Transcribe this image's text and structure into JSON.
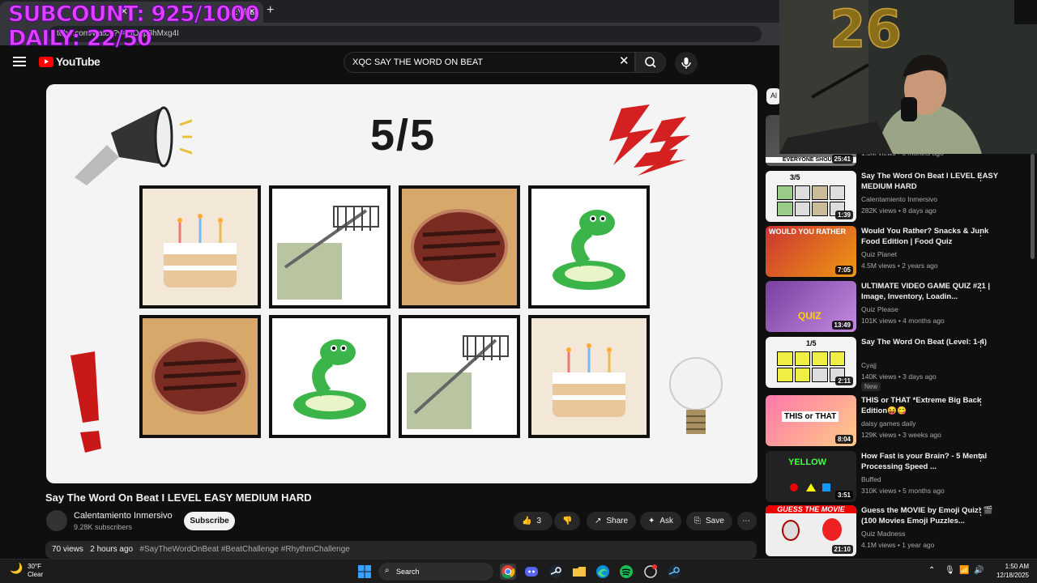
{
  "overlay": {
    "subcount": "SUBCOUNT: 925/1000",
    "daily": "DAILY: 22/50"
  },
  "browser": {
    "tab_title": "LEVEL",
    "url": "tube.com/watch?v=HOgp8hMxg4I"
  },
  "youtube": {
    "logo_text": "YouTube",
    "search_query": "XQC SAY THE WORD ON BEAT"
  },
  "video": {
    "score_text": "5/5",
    "grid_items": [
      "cake",
      "rake",
      "steak",
      "snake",
      "steak",
      "snake",
      "rake",
      "cake"
    ],
    "title": "Say The Word On Beat I LEVEL EASY MEDIUM HARD",
    "channel": "Calentamiento Inmersivo",
    "subscribers": "9.28K subscribers",
    "subscribe_label": "Subscribe",
    "like_count": "3",
    "share_label": "Share",
    "ask_label": "Ask",
    "save_label": "Save",
    "views": "70 views",
    "posted": "2 hours ago",
    "hashtags": "#SayTheWordOnBeat #BeatChallenge #RhythmChallenge"
  },
  "sidebar": {
    "chip_all": "Al",
    "first_meta": "1.3M views • 6 months ago",
    "first_thumb_caption": "EVERYONE SHOULD",
    "first_duration": "25:41",
    "items": [
      {
        "title": "Say The Word On Beat I LEVEL EASY MEDIUM HARD",
        "channel": "Calentamiento Inmersivo",
        "meta": "282K views • 8 days ago",
        "duration": "1:39",
        "thumb_text": "3/5"
      },
      {
        "title": "Would You Rather? Snacks & Junk Food Edition | Food Quiz",
        "channel": "Quiz Planet",
        "meta": "4.5M views • 2 years ago",
        "duration": "7:05",
        "thumb_text": "WOULD YOU RATHER"
      },
      {
        "title": "ULTIMATE VIDEO GAME QUIZ #21 | Image, Inventory, Loadin...",
        "channel": "Quiz Please",
        "meta": "101K views • 4 months ago",
        "duration": "13:49",
        "thumb_text": "QUIZ"
      },
      {
        "title": "Say The Word On Beat (Level: 1-4)",
        "channel": "Cyajj",
        "meta": "140K views • 3 days ago",
        "duration": "2:11",
        "thumb_text": "1/5",
        "badge": "New"
      },
      {
        "title": "THIS or THAT *Extreme Big Back Edition😝😋",
        "channel": "daisy games daily",
        "meta": "129K views • 3 weeks ago",
        "duration": "8:04",
        "thumb_text": "THIS or THAT"
      },
      {
        "title": "How Fast is your Brain? - 5 Mental Processing Speed ...",
        "channel": "Buffed",
        "meta": "310K views • 5 months ago",
        "duration": "3:51",
        "thumb_text": "YELLOW"
      },
      {
        "title": "Guess the MOVIE by Emoji Quiz! 🎬 (100 Movies Emoji Puzzles...",
        "channel": "Quiz Madness",
        "meta": "4.1M views • 1 year ago",
        "duration": "21:10",
        "thumb_text": "GUESS THE MOVIE"
      }
    ]
  },
  "taskbar": {
    "temp": "30°F",
    "condition": "Clear",
    "search_label": "Search",
    "time": "1:50 AM",
    "date": "12/18/2025"
  }
}
